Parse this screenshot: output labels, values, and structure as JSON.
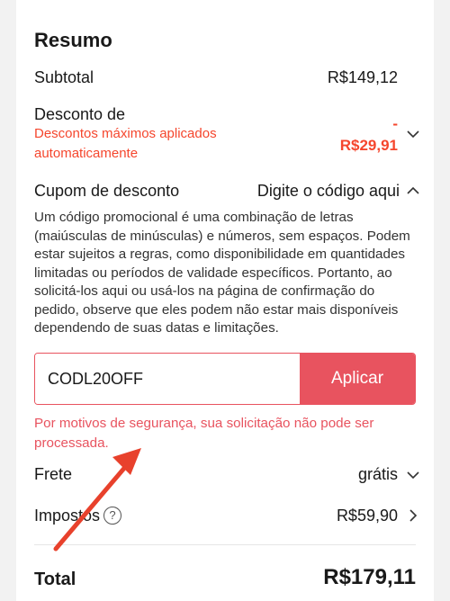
{
  "summary": {
    "title": "Resumo",
    "subtotal_label": "Subtotal",
    "subtotal_value": "R$149,12",
    "discount_label": "Desconto de",
    "discount_note": "Descontos máximos aplicados automaticamente",
    "discount_value": "-\nR$29,91",
    "coupon_label": "Cupom de desconto",
    "coupon_action": "Digite o código aqui",
    "coupon_description": "Um código promocional é uma combinação de letras (maiúsculas de minúsculas) e números, sem espaços. Podem estar sujeitos a regras, como disponibilidade em quantidades limitadas ou períodos de validade específicos. Portanto, ao solicitá-los aqui ou usá-los na página de confirmação do pedido, observe que eles podem não estar mais disponíveis dependendo de suas datas e limitações.",
    "coupon_input_value": "CODL20OFF",
    "apply_label": "Aplicar",
    "error_message": "Por motivos de segurança, sua solicitação não pode ser processada.",
    "shipping_label": "Frete",
    "shipping_value": "grátis",
    "taxes_label": "Impostos",
    "taxes_help": "?",
    "taxes_value": "R$59,90",
    "total_label": "Total",
    "total_value": "R$179,11"
  },
  "colors": {
    "accent": "#f5462d",
    "button": "#e8535f",
    "arrow": "#e8412c"
  },
  "icons": [
    "chevron-down-icon",
    "chevron-up-icon",
    "chevron-right-icon",
    "help-icon",
    "annotation-arrow-icon"
  ]
}
